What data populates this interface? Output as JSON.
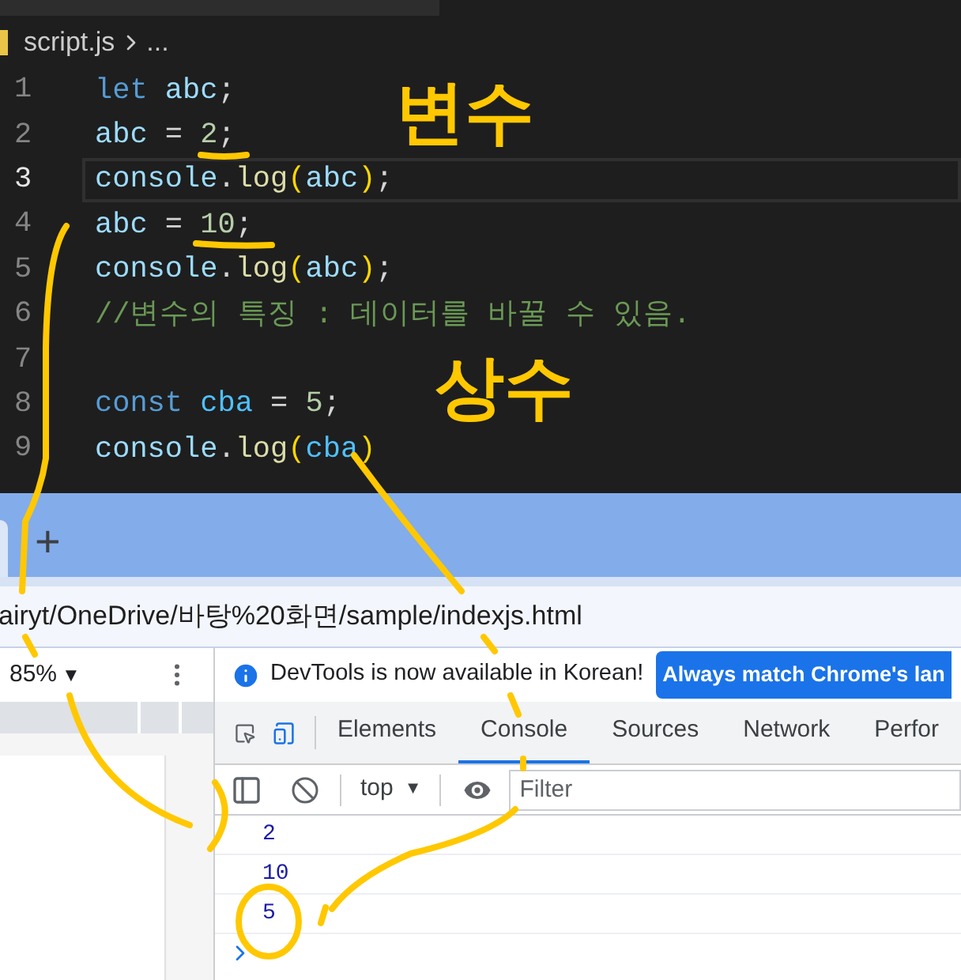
{
  "editor": {
    "breadcrumb": {
      "file": "script.js",
      "more": "..."
    },
    "lines": [
      {
        "number": "1",
        "current": false,
        "tokens": [
          {
            "kind": "keyword",
            "text": "let"
          },
          {
            "kind": "variable",
            "text": " abc"
          },
          {
            "kind": "plain",
            "text": ";"
          }
        ]
      },
      {
        "number": "2",
        "current": false,
        "tokens": [
          {
            "kind": "variable",
            "text": "abc"
          },
          {
            "kind": "plain",
            "text": " = "
          },
          {
            "kind": "number",
            "text": "2"
          },
          {
            "kind": "plain",
            "text": ";"
          }
        ]
      },
      {
        "number": "3",
        "current": true,
        "tokens": [
          {
            "kind": "variable",
            "text": "console"
          },
          {
            "kind": "plain",
            "text": "."
          },
          {
            "kind": "function",
            "text": "log"
          },
          {
            "kind": "paren",
            "text": "("
          },
          {
            "kind": "variable",
            "text": "abc"
          },
          {
            "kind": "paren",
            "text": ")"
          },
          {
            "kind": "plain",
            "text": ";"
          }
        ]
      },
      {
        "number": "4",
        "current": false,
        "tokens": [
          {
            "kind": "variable",
            "text": "abc"
          },
          {
            "kind": "plain",
            "text": " = "
          },
          {
            "kind": "number",
            "text": "10"
          },
          {
            "kind": "plain",
            "text": ";"
          }
        ]
      },
      {
        "number": "5",
        "current": false,
        "tokens": [
          {
            "kind": "variable",
            "text": "console"
          },
          {
            "kind": "plain",
            "text": "."
          },
          {
            "kind": "function",
            "text": "log"
          },
          {
            "kind": "paren",
            "text": "("
          },
          {
            "kind": "variable",
            "text": "abc"
          },
          {
            "kind": "paren",
            "text": ")"
          },
          {
            "kind": "plain",
            "text": ";"
          }
        ]
      },
      {
        "number": "6",
        "current": false,
        "tokens": [
          {
            "kind": "comment",
            "text": "//변수의 특징 : 데이터를 바꿀 수 있음."
          }
        ]
      },
      {
        "number": "7",
        "current": false
      },
      {
        "number": "8",
        "current": false,
        "tokens": [
          {
            "kind": "keyword",
            "text": "const"
          },
          {
            "kind": "constant",
            "text": " cba"
          },
          {
            "kind": "plain",
            "text": " = "
          },
          {
            "kind": "number",
            "text": "5"
          },
          {
            "kind": "plain",
            "text": ";"
          }
        ]
      },
      {
        "number": "9",
        "current": false,
        "tokens": [
          {
            "kind": "variable",
            "text": "console"
          },
          {
            "kind": "plain",
            "text": "."
          },
          {
            "kind": "function",
            "text": "log"
          },
          {
            "kind": "paren",
            "text": "("
          },
          {
            "kind": "constant",
            "text": "cba"
          },
          {
            "kind": "paren",
            "text": ")"
          }
        ]
      }
    ]
  },
  "browser": {
    "new_tab": "+",
    "address": "airyt/OneDrive/바탕%20화면/sample/indexjs.html",
    "zoom": "85%",
    "zoom_caret": "▼"
  },
  "devtools": {
    "notice": "DevTools is now available in Korean!",
    "notice_button": "Always match Chrome's lan",
    "tabs": [
      {
        "label": "Elements",
        "selected": false
      },
      {
        "label": "Console",
        "selected": true
      },
      {
        "label": "Sources",
        "selected": false
      },
      {
        "label": "Network",
        "selected": false
      },
      {
        "label": "Perfor",
        "selected": false
      }
    ],
    "context": "top",
    "context_caret": "▼",
    "filter": {
      "placeholder": "Filter"
    },
    "output": [
      "2",
      "10",
      "5"
    ]
  },
  "annotations": [
    {
      "text": "변수"
    },
    {
      "text": "상수"
    }
  ]
}
